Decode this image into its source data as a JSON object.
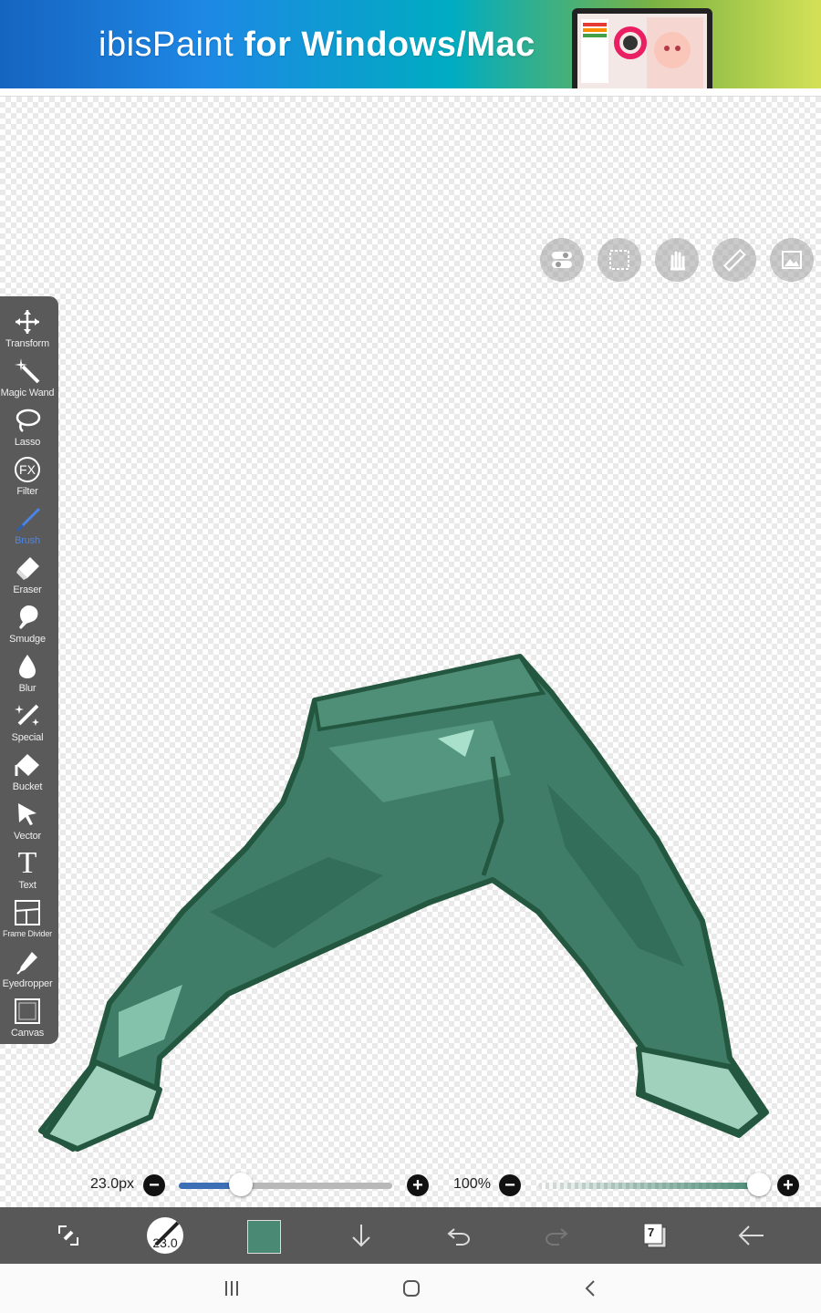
{
  "ad": {
    "brand": "ibisPaint",
    "headline": "for Windows/Mac"
  },
  "toolbar": {
    "tools": [
      {
        "label": "Transform",
        "icon": "move-arrows-icon"
      },
      {
        "label": "Magic Wand",
        "icon": "magic-wand-icon"
      },
      {
        "label": "Lasso",
        "icon": "lasso-icon"
      },
      {
        "label": "Filter",
        "icon": "fx-icon"
      },
      {
        "label": "Brush",
        "icon": "brush-icon",
        "active": true
      },
      {
        "label": "Eraser",
        "icon": "eraser-icon"
      },
      {
        "label": "Smudge",
        "icon": "smudge-icon"
      },
      {
        "label": "Blur",
        "icon": "blur-drop-icon"
      },
      {
        "label": "Special",
        "icon": "special-pen-icon"
      },
      {
        "label": "Bucket",
        "icon": "bucket-icon"
      },
      {
        "label": "Vector",
        "icon": "vector-cursor-icon"
      },
      {
        "label": "Text",
        "icon": "text-t-icon"
      },
      {
        "label": "Frame Divider",
        "icon": "frame-divider-icon"
      },
      {
        "label": "Eyedropper",
        "icon": "eyedropper-icon"
      },
      {
        "label": "Canvas",
        "icon": "canvas-icon"
      }
    ],
    "filter_icon_text": "FX",
    "text_icon_text": "T"
  },
  "quick_actions": [
    "toggle-icon",
    "selection-icon",
    "hand-icon",
    "ruler-icon",
    "reference-image-icon"
  ],
  "brush": {
    "size_label": "23.0px",
    "size_fraction": 0.29,
    "opacity_label": "100%",
    "opacity_fraction": 1.0,
    "preview_size": "23.0"
  },
  "color": {
    "current": "#4a8a74",
    "accent": "#3d6fb6"
  },
  "bottombar": {
    "layer_count": "7"
  }
}
